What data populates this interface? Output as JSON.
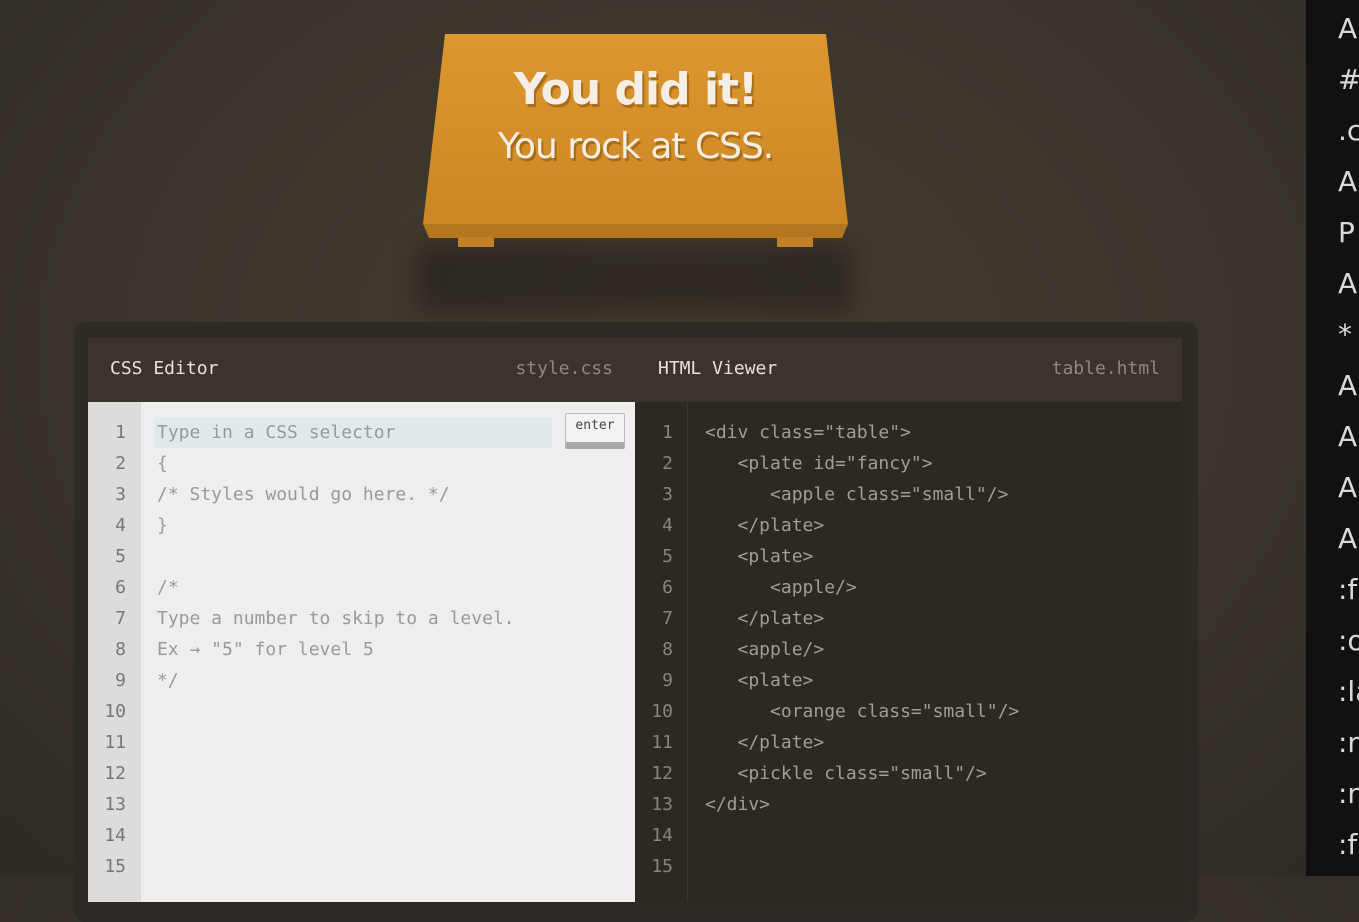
{
  "banner": {
    "line1": "You did it!",
    "line2": "You rock at CSS."
  },
  "css_editor": {
    "title": "CSS Editor",
    "filename": "style.css",
    "input_placeholder": "Type in a CSS selector",
    "enter_label": "enter",
    "line_numbers": [
      "1",
      "2",
      "3",
      "4",
      "5",
      "6",
      "7",
      "8",
      "9",
      "10",
      "11",
      "12",
      "13",
      "14",
      "15"
    ],
    "code": [
      "",
      "{",
      "/* Styles would go here. */",
      "}",
      "",
      "/*",
      "Type a number to skip to a level.",
      "Ex → \"5\" for level 5",
      "*/"
    ]
  },
  "html_viewer": {
    "title": "HTML Viewer",
    "filename": "table.html",
    "line_numbers": [
      "1",
      "2",
      "3",
      "4",
      "5",
      "6",
      "7",
      "8",
      "9",
      "10",
      "11",
      "12",
      "13",
      "14",
      "15"
    ],
    "code": [
      "<div class=\"table\">",
      "   <plate id=\"fancy\">",
      "      <apple class=\"small\"/>",
      "   </plate>",
      "   <plate>",
      "      <apple/>",
      "   </plate>",
      "   <apple/>",
      "   <plate>",
      "      <orange class=\"small\"/>",
      "   </plate>",
      "   <pickle class=\"small\"/>",
      "</div>"
    ]
  },
  "sidebar": {
    "items": [
      "A",
      "#",
      ".c",
      "A",
      "P",
      "A",
      "*",
      "A",
      "A",
      "A",
      "A",
      ":f",
      ":o",
      ":la",
      ":n",
      ":n",
      ":f"
    ]
  },
  "colors": {
    "accent": "#dc972f",
    "background": "#3a342c",
    "editor_bg": "#eeeeee",
    "viewer_bg": "#2c2822"
  }
}
